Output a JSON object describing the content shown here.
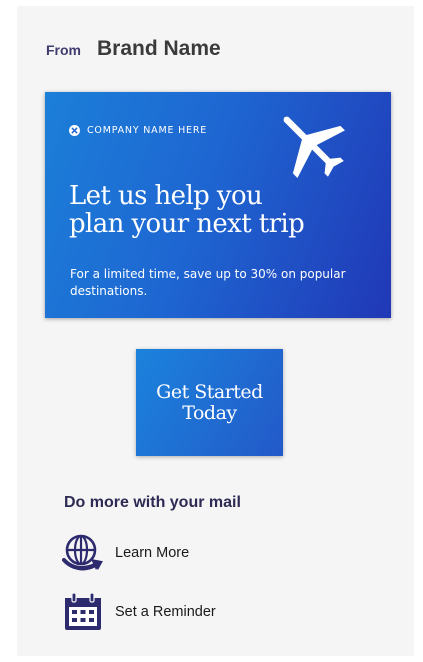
{
  "header": {
    "from_label": "From",
    "brand_name": "Brand Name"
  },
  "banner": {
    "company_name": "COMPANY NAME HERE",
    "headline_line1": "Let us help you",
    "headline_line2": "plan your next trip",
    "subtext": "For a limited time, save up to 30% on popular destinations.",
    "icons": [
      "close-circle-icon",
      "airplane-icon"
    ]
  },
  "cta": {
    "line1": "Get Started",
    "line2": "Today"
  },
  "more": {
    "title": "Do more with your mail",
    "actions": [
      {
        "label": "Learn More",
        "icon": "globe-arrow-icon"
      },
      {
        "label": "Set a Reminder",
        "icon": "calendar-icon"
      }
    ]
  },
  "colors": {
    "banner_start": "#1c7fd8",
    "banner_end": "#2138b6",
    "icon_navy": "#2d2b6e",
    "background": "#f5f5f6"
  }
}
